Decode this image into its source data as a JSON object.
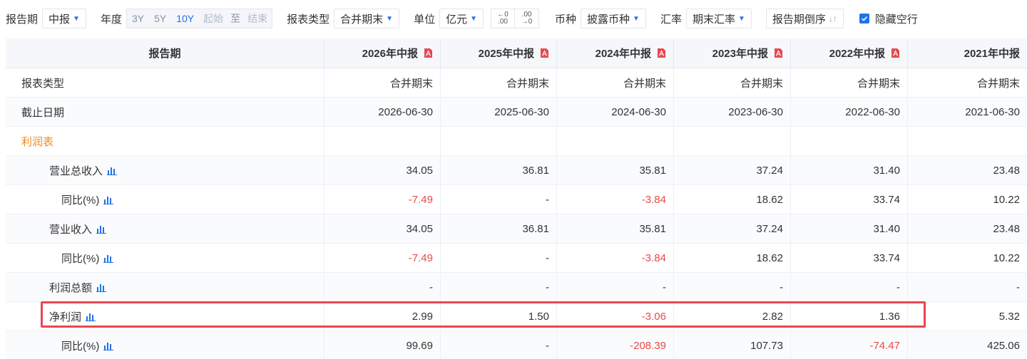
{
  "toolbar": {
    "period_label": "报告期",
    "period_value": "中报",
    "year_label": "年度",
    "year_options": [
      "3Y",
      "5Y",
      "10Y"
    ],
    "year_active": "10Y",
    "start_placeholder": "起始",
    "to_label": "至",
    "end_placeholder": "结束",
    "report_type_label": "报表类型",
    "report_type_value": "合并期末",
    "unit_label": "单位",
    "unit_value": "亿元",
    "dec_inc_top": "←0",
    "dec_inc_bottom": ".00",
    "dec_dec_top": ".00",
    "dec_dec_bottom": "→0",
    "currency_label": "币种",
    "currency_value": "披露币种",
    "fx_label": "汇率",
    "fx_value": "期末汇率",
    "sort_label": "报告期倒序",
    "hide_empty_label": "隐藏空行",
    "hide_empty_checked": true
  },
  "table": {
    "header_first": "报告期",
    "columns": [
      "2026年中报",
      "2025年中报",
      "2024年中报",
      "2023年中报",
      "2022年中报",
      "2021年中报"
    ],
    "rows": [
      {
        "label": "报表类型",
        "values": [
          "合并期末",
          "合并期末",
          "合并期末",
          "合并期末",
          "合并期末",
          "合并期末"
        ]
      },
      {
        "label": "截止日期",
        "values": [
          "2026-06-30",
          "2025-06-30",
          "2024-06-30",
          "2023-06-30",
          "2022-06-30",
          "2021-06-30"
        ]
      },
      {
        "label": "利润表",
        "values": [
          "",
          "",
          "",
          "",
          "",
          ""
        ]
      },
      {
        "label": "营业总收入",
        "values": [
          "34.05",
          "36.81",
          "35.81",
          "37.24",
          "31.40",
          "23.48"
        ]
      },
      {
        "label": "同比(%)",
        "values": [
          "-7.49",
          "-",
          "-3.84",
          "18.62",
          "33.74",
          "10.22"
        ]
      },
      {
        "label": "营业收入",
        "values": [
          "34.05",
          "36.81",
          "35.81",
          "37.24",
          "31.40",
          "23.48"
        ]
      },
      {
        "label": "同比(%)",
        "values": [
          "-7.49",
          "-",
          "-3.84",
          "18.62",
          "33.74",
          "10.22"
        ]
      },
      {
        "label": "利润总额",
        "values": [
          "-",
          "-",
          "-",
          "-",
          "-",
          "-"
        ]
      },
      {
        "label": "净利润",
        "values": [
          "2.99",
          "1.50",
          "-3.06",
          "2.82",
          "1.36",
          "5.32"
        ]
      },
      {
        "label": "同比(%)",
        "values": [
          "99.69",
          "-",
          "-208.39",
          "107.73",
          "-74.47",
          "425.06"
        ]
      }
    ]
  },
  "colors": {
    "accent": "#1e73e8",
    "negative": "#e84a4a",
    "section": "#f08a24",
    "highlight_box": "#e8474f",
    "pdf_icon": "#e8474f"
  }
}
